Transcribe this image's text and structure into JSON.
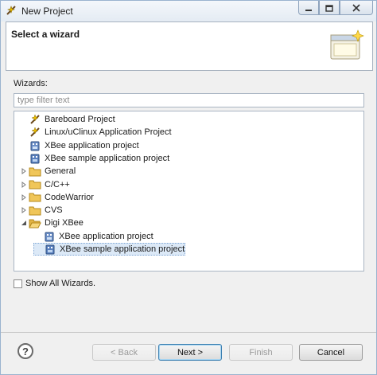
{
  "window": {
    "title": "New Project"
  },
  "header": {
    "title": "Select a wizard"
  },
  "wizards_label": "Wizards:",
  "filter": {
    "placeholder": "type filter text",
    "value": ""
  },
  "tree": [
    {
      "label": "Bareboard Project",
      "icon": "bareboard-project-icon",
      "level": 0,
      "expander": "none"
    },
    {
      "label": "Linux/uClinux Application Project",
      "icon": "linux-project-icon",
      "level": 0,
      "expander": "none"
    },
    {
      "label": "XBee application project",
      "icon": "xbee-project-icon",
      "level": 0,
      "expander": "none"
    },
    {
      "label": "XBee sample application project",
      "icon": "xbee-sample-project-icon",
      "level": 0,
      "expander": "none"
    },
    {
      "label": "General",
      "icon": "folder-icon",
      "level": 0,
      "expander": "collapsed"
    },
    {
      "label": "C/C++",
      "icon": "folder-icon",
      "level": 0,
      "expander": "collapsed"
    },
    {
      "label": "CodeWarrior",
      "icon": "folder-icon",
      "level": 0,
      "expander": "collapsed"
    },
    {
      "label": "CVS",
      "icon": "folder-icon",
      "level": 0,
      "expander": "collapsed"
    },
    {
      "label": "Digi XBee",
      "icon": "folder-open-icon",
      "level": 0,
      "expander": "expanded"
    },
    {
      "label": "XBee application project",
      "icon": "xbee-project-icon",
      "level": 1,
      "expander": "none"
    },
    {
      "label": "XBee sample application project",
      "icon": "xbee-sample-project-icon",
      "level": 1,
      "expander": "none",
      "selected": true
    }
  ],
  "show_all": {
    "label": "Show All Wizards.",
    "checked": false
  },
  "footer": {
    "back": "< Back",
    "next": "Next >",
    "finish": "Finish",
    "cancel": "Cancel"
  },
  "colors": {
    "selection": "#dce9f7",
    "folder": "#e8b84a",
    "accent": "#3c7fb1"
  }
}
